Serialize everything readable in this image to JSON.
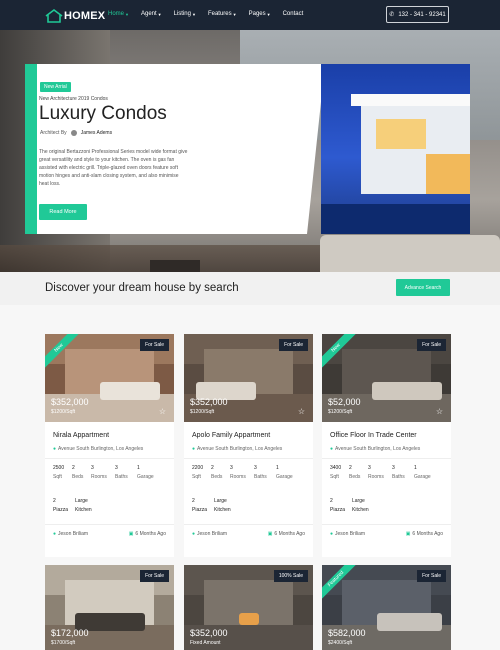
{
  "brand": {
    "name": "HOMEX",
    "accent": "#20c997",
    "nav_bg": "#1b2534"
  },
  "nav": {
    "items": [
      {
        "label": "Home",
        "caret": true
      },
      {
        "label": "Agent",
        "caret": true
      },
      {
        "label": "Listing",
        "caret": true
      },
      {
        "label": "Features",
        "caret": true
      },
      {
        "label": "Pages",
        "caret": true
      },
      {
        "label": "Contact",
        "caret": false
      }
    ],
    "phone": "132 - 341 - 92341"
  },
  "hero": {
    "badge": "New Arrial",
    "subtitle": "New Architecture 2019 Condos",
    "title": "Luxury Condos",
    "architect_label": "Architect By",
    "architect_name": "James Adems",
    "description": "The original Bertazzoni Professional Series model wide format give great versatility and style to your kitchen. The oven is gas fan assisted with electric grill. Triple-glazed oven doors feature soft motion hinges and anti-slam closing system, and also minimise heat loss.",
    "button": "Read More",
    "dots": 4,
    "active_dot": 2
  },
  "search": {
    "title": "Discover your dream house by search",
    "button": "Advance Search"
  },
  "listings": [
    {
      "status": "For Sale",
      "ribbon": "New",
      "price": "$352,000",
      "area": "$1200/Sqft",
      "title": "Nirala Appartment",
      "address": "Avenue South Burlington, Los Angeles",
      "stats": [
        [
          "2500",
          "Sqft"
        ],
        [
          "2",
          "Beds"
        ],
        [
          "3",
          "Rooms"
        ],
        [
          "3",
          "Baths"
        ],
        [
          "1",
          "Garage"
        ]
      ],
      "extra": [
        [
          "2",
          "Piazza"
        ],
        [
          "Large",
          "Kitchen"
        ]
      ],
      "agent": "Jeson Briliam",
      "posted": "6 Months Ago"
    },
    {
      "status": "For Sale",
      "ribbon": "",
      "price": "$352,000",
      "area": "$1200/Sqft",
      "title": "Apolo Family Appartment",
      "address": "Avenue South Burlington, Los Angeles",
      "stats": [
        [
          "2200",
          "Sqft"
        ],
        [
          "2",
          "Beds"
        ],
        [
          "3",
          "Rooms"
        ],
        [
          "3",
          "Baths"
        ],
        [
          "1",
          "Garage"
        ]
      ],
      "extra": [
        [
          "2",
          "Piazza"
        ],
        [
          "Large",
          "Kitchen"
        ]
      ],
      "agent": "Jeson Briliam",
      "posted": "6 Months Ago"
    },
    {
      "status": "For Sale",
      "ribbon": "New",
      "price": "$52,000",
      "area": "$1200/Sqft",
      "title": "Office Floor In Trade Center",
      "address": "Avenue South Burlington, Los Angeles",
      "stats": [
        [
          "3400",
          "Sqft"
        ],
        [
          "2",
          "Beds"
        ],
        [
          "3",
          "Rooms"
        ],
        [
          "3",
          "Baths"
        ],
        [
          "1",
          "Garage"
        ]
      ],
      "extra": [
        [
          "2",
          "Piazza"
        ],
        [
          "Large",
          "Kitchen"
        ]
      ],
      "agent": "Jeson Briliam",
      "posted": "6 Months Ago"
    },
    {
      "status": "For Sale",
      "ribbon": "",
      "price": "$172,000",
      "area": "$1700/Sqft"
    },
    {
      "status": "100% Sale",
      "ribbon": "",
      "price": "$352,000",
      "area": "Fixed Amount"
    },
    {
      "status": "For Sale",
      "ribbon": "Featured",
      "price": "$582,000",
      "area": "$2400/Sqft"
    }
  ]
}
